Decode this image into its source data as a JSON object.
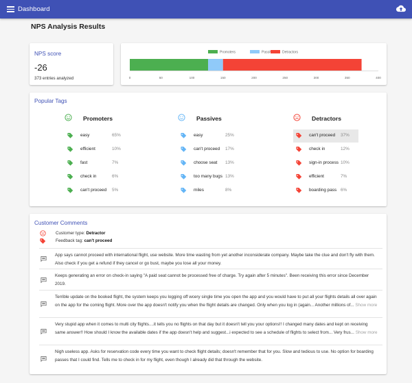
{
  "app_bar": {
    "title": "Dashboard",
    "menu_icon": "menu-icon",
    "upload_icon": "cloud-upload-icon",
    "color": "#3f51b5"
  },
  "page": {
    "title": "NPS Analysis Results"
  },
  "nps_card": {
    "title": "NPS score",
    "score": "-26",
    "entries": "373 entries analyzed"
  },
  "chart_data": {
    "type": "bar",
    "orientation": "horizontal",
    "stacked": true,
    "series": [
      {
        "name": "Promoters",
        "values": [
          126
        ],
        "color": "#4caf50"
      },
      {
        "name": "Passives",
        "values": [
          24
        ],
        "color": "#90caf9"
      },
      {
        "name": "Detractors",
        "values": [
          223
        ],
        "color": "#f44336"
      }
    ],
    "xlim": [
      0,
      400
    ],
    "x_ticks": [
      "0",
      "50",
      "100",
      "150",
      "200",
      "250",
      "300",
      "350",
      "400"
    ],
    "legend": "top",
    "grid": false
  },
  "tags": {
    "title": "Popular Tags",
    "columns": [
      {
        "name": "Promoters",
        "face_icon": "smile-icon",
        "color": "#4caf50",
        "items": [
          {
            "tag": "easy",
            "pct": "65%"
          },
          {
            "tag": "efficient",
            "pct": "10%"
          },
          {
            "tag": "fast",
            "pct": "7%"
          },
          {
            "tag": "check in",
            "pct": "6%"
          },
          {
            "tag": "can't proceed",
            "pct": "5%"
          }
        ]
      },
      {
        "name": "Passives",
        "face_icon": "neutral-face-icon",
        "color": "#64b5f6",
        "items": [
          {
            "tag": "easy",
            "pct": "25%"
          },
          {
            "tag": "can't proceed",
            "pct": "17%"
          },
          {
            "tag": "choose seat",
            "pct": "13%"
          },
          {
            "tag": "too many bugs",
            "pct": "13%"
          },
          {
            "tag": "miles",
            "pct": "8%"
          }
        ]
      },
      {
        "name": "Detractors",
        "face_icon": "frown-icon",
        "color": "#f44336",
        "items": [
          {
            "tag": "can't proceed",
            "pct": "37%"
          },
          {
            "tag": "check in",
            "pct": "12%"
          },
          {
            "tag": "sign-in process",
            "pct": "10%"
          },
          {
            "tag": "efficient",
            "pct": "7%"
          },
          {
            "tag": "boarding pass",
            "pct": "6%"
          }
        ]
      }
    ]
  },
  "comments": {
    "title": "Customer Comments",
    "filter_type_label": "Customer type:",
    "filter_type_value": "Detractor",
    "filter_tag_label": "Feedback tag:",
    "filter_tag_value": "can't proceed",
    "show_more": "Show more",
    "items": [
      {
        "text": "App says cannot proceed with international flight, use website. More time wasting from yet another inconsiderate company. Maybe take the clue and don't fly with them. Also check if you get a refund if they cancel or go bust, maybe you lose all your money.",
        "truncated": false
      },
      {
        "text": "Keeps generating an error on check-in saying \"A paid seat cannot be processed free of charge. Try again after 5 minutes\". Been receiving this error since December 2019.",
        "truncated": false
      },
      {
        "text": "Terrible update on the booked flight, the system keeps you logging off wcery single time you open the app and you would have to put all your flights details all over again on the app for the coming flight. More over the app doesn't notify you when the flight details are changed. Only when you log in (again... Another millions of...",
        "truncated": true
      },
      {
        "text": "Very stupid app when it comes to multi city flights....it tells you no flights on that day but it doesn't tell you your options!! I changed many dates and kept on receiving same answer!! How should I know the available dates if the app doesn't help and suggest...i expected to see a schedule of flights to select from... Very frus...",
        "truncated": true
      },
      {
        "text": "Nigh useless app. Asks for reservation code every time you want to check flight details; doesn't remember that for you. Slow and tedious to use. No option for boarding passes that I could find. Tells me to check in for my flight, even though I already did that through the website.",
        "truncated": false
      }
    ]
  }
}
